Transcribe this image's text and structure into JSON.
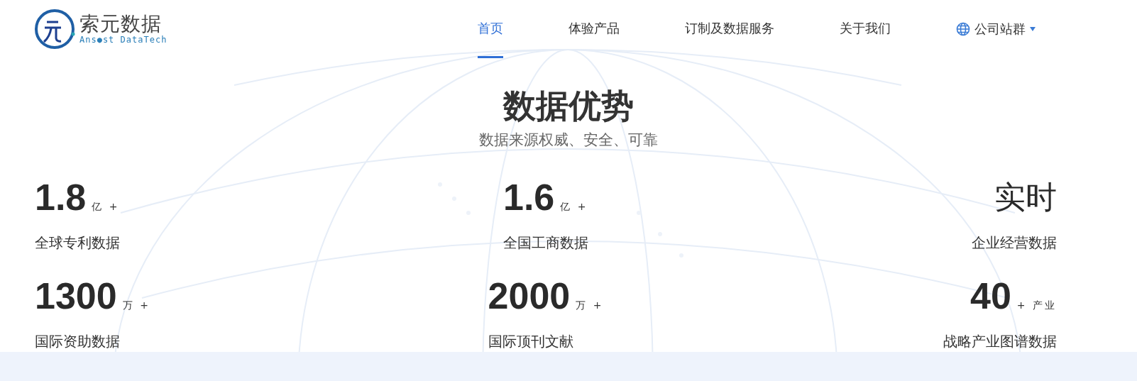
{
  "logo": {
    "name": "索元数据",
    "tagline": "Ans●st DataTech"
  },
  "nav": [
    {
      "label": "首页",
      "selected": true
    },
    {
      "label": "体验产品",
      "selected": false
    },
    {
      "label": "订制及数据服务",
      "selected": false
    },
    {
      "label": "关于我们",
      "selected": false
    }
  ],
  "site_group": {
    "label": "公司站群"
  },
  "section": {
    "title": "数据优势",
    "subtitle": "数据来源权威、安全、可靠"
  },
  "stats": [
    {
      "kind": "figure",
      "value": "1.8",
      "unit": "亿 +",
      "label": "全球专利数据"
    },
    {
      "kind": "figure",
      "value": "1.6",
      "unit": "亿 +",
      "label": "全国工商数据"
    },
    {
      "kind": "word",
      "value": "实时",
      "label": "企业经营数据"
    },
    {
      "kind": "figure",
      "value": "1300",
      "unit": "万 +",
      "label": "国际资助数据"
    },
    {
      "kind": "figure",
      "value": "2000",
      "unit": "万 +",
      "label": "国际顶刊文献"
    },
    {
      "kind": "figure",
      "value": "40",
      "unit": "+ 产业",
      "label": "战略产业图谱数据"
    }
  ]
}
